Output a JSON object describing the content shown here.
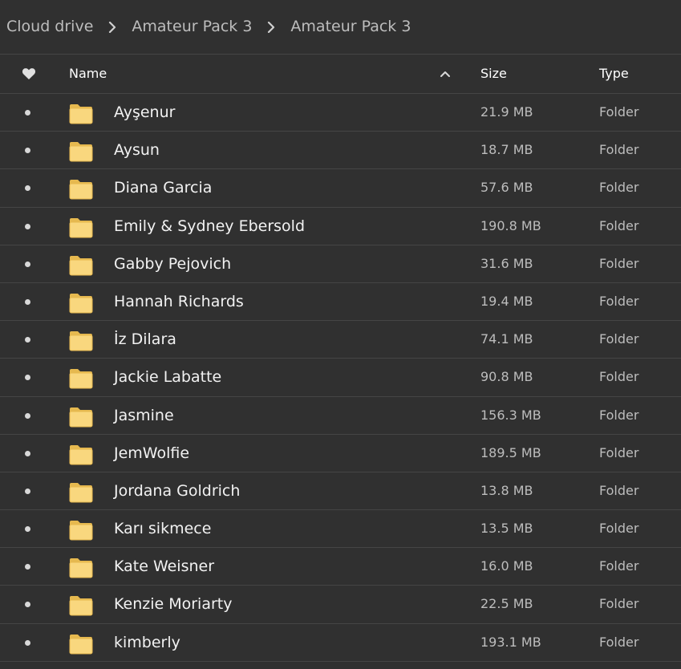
{
  "breadcrumb": {
    "items": [
      "Cloud drive",
      "Amateur Pack 3",
      "Amateur Pack 3"
    ]
  },
  "header": {
    "name_label": "Name",
    "size_label": "Size",
    "type_label": "Type",
    "sort_direction": "ascending"
  },
  "colors": {
    "background": "#303030",
    "folder": "#f9d77e",
    "folder_dark": "#e6b94f"
  },
  "files": [
    {
      "name": "Ayşenur",
      "size": "21.9 MB",
      "type": "Folder"
    },
    {
      "name": "Aysun",
      "size": "18.7 MB",
      "type": "Folder"
    },
    {
      "name": "Diana Garcia",
      "size": "57.6 MB",
      "type": "Folder"
    },
    {
      "name": "Emily & Sydney Ebersold",
      "size": "190.8 MB",
      "type": "Folder"
    },
    {
      "name": "Gabby Pejovich",
      "size": "31.6 MB",
      "type": "Folder"
    },
    {
      "name": "Hannah Richards",
      "size": "19.4 MB",
      "type": "Folder"
    },
    {
      "name": "İz Dilara",
      "size": "74.1 MB",
      "type": "Folder"
    },
    {
      "name": "Jackie Labatte",
      "size": "90.8 MB",
      "type": "Folder"
    },
    {
      "name": "Jasmine",
      "size": "156.3 MB",
      "type": "Folder"
    },
    {
      "name": "JemWolfie",
      "size": "189.5 MB",
      "type": "Folder"
    },
    {
      "name": "Jordana Goldrich",
      "size": "13.8 MB",
      "type": "Folder"
    },
    {
      "name": "Karı sikmece",
      "size": "13.5 MB",
      "type": "Folder"
    },
    {
      "name": "Kate Weisner",
      "size": "16.0 MB",
      "type": "Folder"
    },
    {
      "name": "Kenzie Moriarty",
      "size": "22.5 MB",
      "type": "Folder"
    },
    {
      "name": "kimberly",
      "size": "193.1 MB",
      "type": "Folder"
    }
  ]
}
